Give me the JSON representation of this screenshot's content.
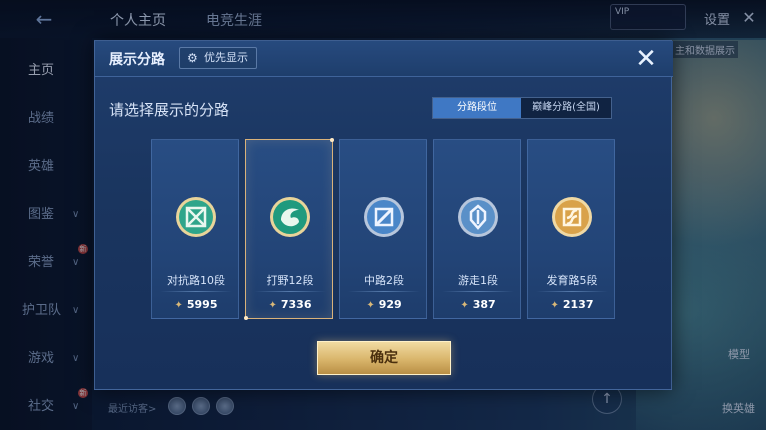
{
  "background": {
    "top_tabs": [
      "个人主页",
      "电竞生涯"
    ],
    "settings_label": "设置",
    "vip_text": "VIP",
    "sidebar_items": [
      {
        "label": "主页",
        "has_chevron": false,
        "badge": ""
      },
      {
        "label": "战绩",
        "has_chevron": false,
        "badge": ""
      },
      {
        "label": "英雄",
        "has_chevron": false,
        "badge": ""
      },
      {
        "label": "图鉴",
        "has_chevron": true,
        "badge": ""
      },
      {
        "label": "荣誉",
        "has_chevron": true,
        "badge": "新"
      },
      {
        "label": "护卫队",
        "has_chevron": true,
        "badge": ""
      },
      {
        "label": "游戏",
        "has_chevron": true,
        "badge": ""
      },
      {
        "label": "社交",
        "has_chevron": true,
        "badge": "新"
      }
    ],
    "recent_visitors_label": "最近访客>",
    "model_label": "模型",
    "change_hero_label": "换英雄",
    "top_right_snippet": "主和数据展示"
  },
  "dialog": {
    "title": "展示分路",
    "priority_button": "优先显示",
    "prompt": "请选择展示的分路",
    "segments": [
      {
        "label": "分路段位",
        "active": true
      },
      {
        "label": "巅峰分路(全国)",
        "active": false
      }
    ],
    "lanes": [
      {
        "label": "对抗路10段",
        "points": "5995",
        "selected": false,
        "icon": "clash-lane-icon",
        "color": "#2fa58a"
      },
      {
        "label": "打野12段",
        "points": "7336",
        "selected": true,
        "icon": "jungle-icon",
        "color": "#1f9a7e"
      },
      {
        "label": "中路2段",
        "points": "929",
        "selected": false,
        "icon": "mid-lane-icon",
        "color": "#4a86c8"
      },
      {
        "label": "游走1段",
        "points": "387",
        "selected": false,
        "icon": "roam-icon",
        "color": "#5a90c8"
      },
      {
        "label": "发育路5段",
        "points": "2137",
        "selected": false,
        "icon": "farm-lane-icon",
        "color": "#d9a24a"
      }
    ],
    "confirm_button": "确定"
  }
}
